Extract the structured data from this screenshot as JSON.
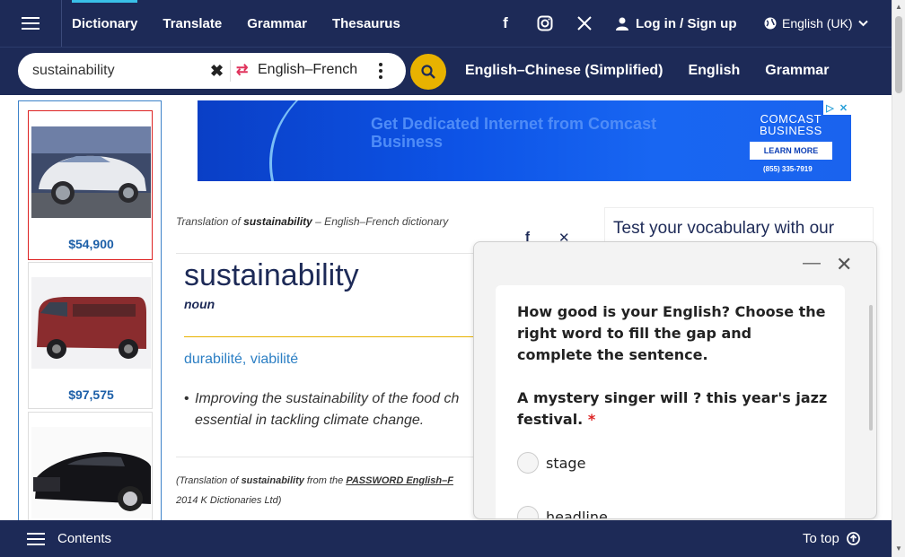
{
  "topnav": {
    "items": [
      {
        "label": "Dictionary",
        "active": true
      },
      {
        "label": "Translate",
        "active": false
      },
      {
        "label": "Grammar",
        "active": false
      },
      {
        "label": "Thesaurus",
        "active": false
      }
    ],
    "social": [
      "facebook-icon",
      "instagram-icon",
      "x-icon"
    ],
    "login_label": "Log in / Sign up",
    "language_label": "English (UK)"
  },
  "search": {
    "value": "sustainability",
    "dictionary_label": "English–French"
  },
  "subnav": {
    "items": [
      "English–Chinese (Simplified)",
      "English",
      "Grammar"
    ]
  },
  "ads": {
    "cars": [
      {
        "price": "$54,900"
      },
      {
        "price": "$97,575"
      },
      {
        "price": ""
      }
    ],
    "banner": {
      "headline": "Get Dedicated Internet from Comcast Business",
      "brand_line1": "COMCAST",
      "brand_line2": "BUSINESS",
      "cta": "LEARN MORE",
      "phone": "(855) 335-7919"
    }
  },
  "entry": {
    "caption_prefix": "Translation of ",
    "caption_word": "sustainability",
    "caption_suffix": " – English–French dictionary",
    "headword": "sustainability",
    "pos": "noun",
    "translation": "durabilité, viabilité",
    "example": "Improving the sustainability of the food ch",
    "example_line2": "essential in tackling climate change.",
    "source_prefix": "(Translation of ",
    "source_word": "sustainability",
    "source_mid": " from the ",
    "source_link": "PASSWORD English–F",
    "source_line2": "2014 K Dictionaries Ltd)"
  },
  "vocab": {
    "title": "Test your vocabulary with our"
  },
  "quiz": {
    "question1": "How good is your English? Choose the right word to fill the gap and complete the sentence.",
    "question2": "A mystery singer will ? this year's jazz festival.",
    "required_mark": "*",
    "options": [
      "stage",
      "headline"
    ]
  },
  "bottombar": {
    "contents_label": "Contents",
    "totop_label": "To top"
  },
  "colors": {
    "navy": "#1d2a57",
    "accent_yellow": "#e8b200",
    "link_blue": "#2c7fc4",
    "swap_red": "#e0335c"
  }
}
